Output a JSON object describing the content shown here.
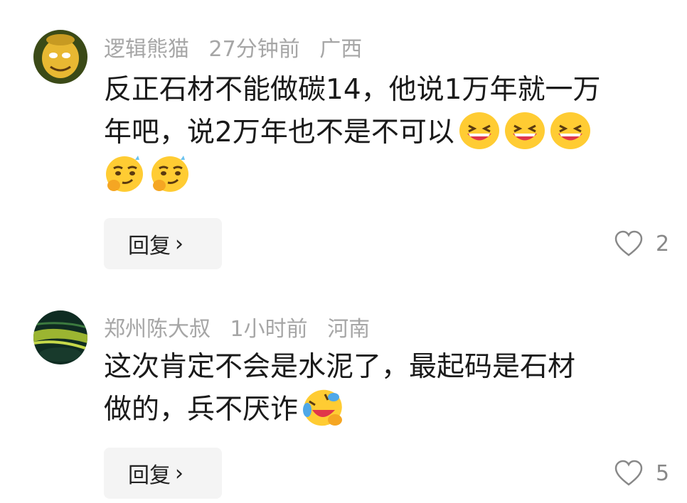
{
  "comments": [
    {
      "username": "逻辑熊猫",
      "time": "27分钟前",
      "location": "广西",
      "text_line1": "反正石材不能做碳14，他说1万年就一万",
      "text_line2": "年吧，说2万年也不是不可以",
      "emojis_line2": [
        "grin-emoji",
        "grin-emoji",
        "grin-emoji"
      ],
      "emojis_line3": [
        "smirk-emoji",
        "smirk-emoji"
      ],
      "reply_label": "回复",
      "reply_chevron": "›",
      "like_count": "2"
    },
    {
      "username": "郑州陈大叔",
      "time": "1小时前",
      "location": "河南",
      "text_line1": "这次肯定不会是水泥了，最起码是石材",
      "text_line2": "做的，兵不厌诈",
      "emojis_line2": [
        "laugh-cry-emoji"
      ],
      "reply_label": "回复",
      "reply_chevron": "›",
      "like_count": "5"
    }
  ],
  "colors": {
    "meta_text": "#a6a6a6",
    "body_text": "#1a1a1a",
    "reply_bg": "#f4f4f4",
    "like_icon": "#888888"
  }
}
